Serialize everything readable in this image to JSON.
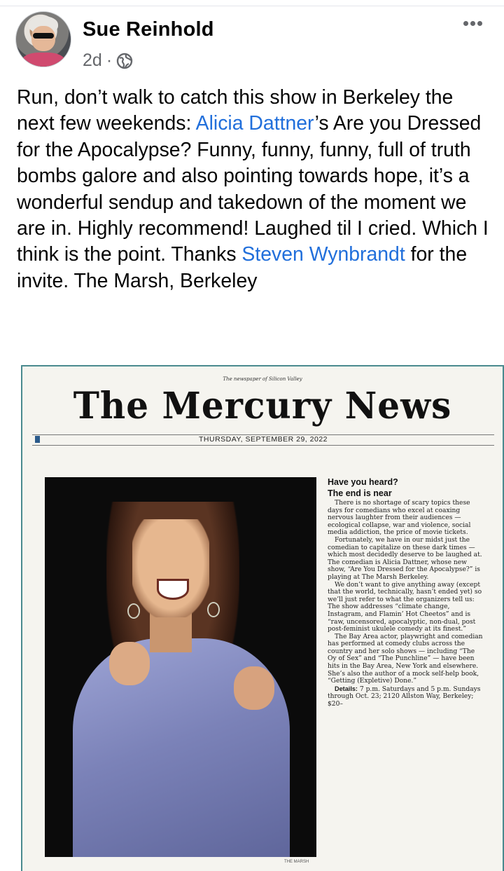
{
  "post": {
    "author": "Sue Reinhold",
    "time": "2d",
    "separator": "·",
    "privacy_icon": "globe-icon",
    "more_icon": "more-horizontal-icon",
    "text_parts": [
      "Run, don’t walk to catch this show in Berkeley the next few weekends: ",
      "Alicia Dattner",
      "’s Are you Dressed for the Apocalypse? Funny, funny, funny, full of truth bombs galore and also pointing towards hope, it’s a wonderful sendup and takedown of the moment we are in. Highly recommend! Laughed til I cried. Which I think is the point. Thanks ",
      "Steven Wynbrandt",
      " for the invite. The Marsh, Berkeley"
    ],
    "link_color": "#216fdb"
  },
  "newspaper": {
    "tagline": "The newspaper of Silicon Valley",
    "masthead": "The Mercury News",
    "date": "THURSDAY, SEPTEMBER 29, 2022",
    "photo_credit": "THE MARSH",
    "headline_1": "Have you heard?",
    "headline_2": "The end is near",
    "paragraphs": [
      "There is no shortage of scary topics these days for comedians who excel at coaxing nervous laughter from their audiences — ecological collapse, war and violence, social media addiction, the price of movie tickets.",
      "Fortunately, we have in our midst just the comedian to capitalize on these dark times — which most decidedly deserve to be laughed at. The comedian is Alicia Dattner, whose new show, “Are You Dressed for the Apocalypse?” is playing at The Marsh Berkeley.",
      "We don’t want to give anything away (except that the world, technically, hasn’t ended yet) so we’ll just refer to what the organizers tell us: The show addresses “climate change, Instagram, and Flamin’ Hot Cheetos” and is “raw, uncensored, apocalyptic, non-dual, post post-feminist ukulele comedy at its finest.”",
      "The Bay Area actor, playwright and comedian has performed at comedy clubs across the country and her solo shows — including “The Oy of Sex” and “The Punchline” — have been hits in the Bay Area, New York and elsewhere. She’s also the author of a mock self-help book, “Getting (Expletive) Done.”"
    ],
    "details_label": "Details:",
    "details_text": " 7 p.m. Saturdays and 5 p.m. Sundays through Oct. 23; 2120 Allston Way, Berkeley; $20–"
  }
}
